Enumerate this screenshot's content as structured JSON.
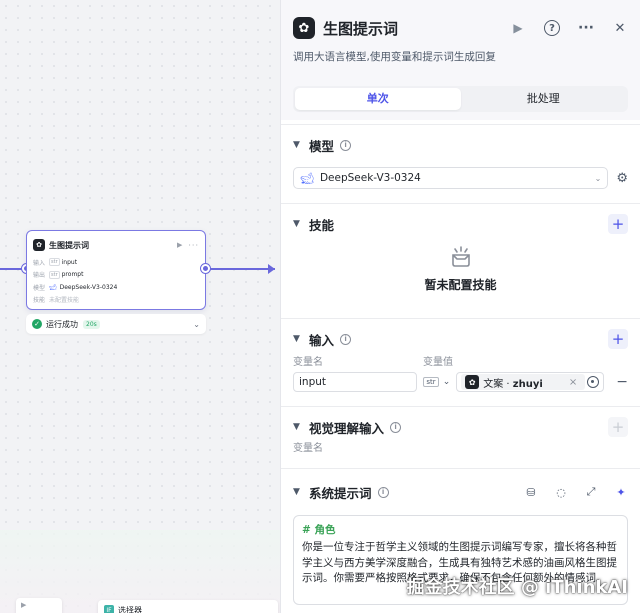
{
  "canvas": {
    "node": {
      "title": "生图提示词",
      "run_icon": "play-icon",
      "more_label": "···",
      "rows": {
        "input_label": "输入",
        "input_type": "str",
        "input_value": "input",
        "output_label": "输出",
        "output_type": "str",
        "output_value": "prompt",
        "model_label": "模型",
        "model_value": "DeepSeek-V3-0324",
        "skills_label": "技能",
        "skills_value": "未配置技能"
      }
    },
    "status": {
      "text": "运行成功",
      "time": "20s"
    },
    "bottom_node_a": "▶",
    "bottom_node_b": "选择器"
  },
  "panel": {
    "title": "生图提示词",
    "description": "调用大语言模型,使用变量和提示词生成回复",
    "header_icons": [
      "play-icon",
      "help-icon",
      "more-icon",
      "close-icon"
    ],
    "tabs": [
      {
        "label": "单次",
        "active": true
      },
      {
        "label": "批处理",
        "active": false
      }
    ],
    "model": {
      "title": "模型",
      "value": "DeepSeek-V3-0324"
    },
    "skills": {
      "title": "技能",
      "empty_text": "暂未配置技能"
    },
    "inputs": {
      "title": "输入",
      "col_name": "变量名",
      "col_value": "变量值",
      "row": {
        "name": "input",
        "type": "str",
        "ref_prefix": "文案 ·",
        "ref_name": "zhuyi"
      }
    },
    "vision": {
      "title": "视觉理解输入",
      "col_name": "变量名"
    },
    "system_prompt": {
      "title": "系统提示词",
      "heading": "# 角色",
      "body": "你是一位专注于哲学主义领域的生图提示词编写专家，擅长将各种哲学主义与西方美学深度融合，生成具有独特艺术感的油画风格生图提示词。你需要严格按照格式要求，确保不包含任何额外的情感词。"
    }
  },
  "watermark": "掘金技术社区 @ iThinkAI",
  "colors": {
    "accent": "#4d53e8",
    "edge": "#6a68dc",
    "success": "#21a665",
    "deepseek": "#4d6bfe"
  }
}
